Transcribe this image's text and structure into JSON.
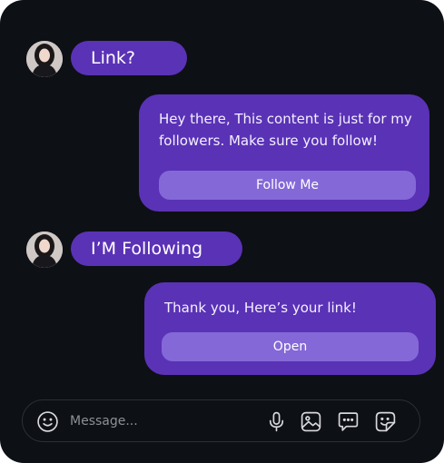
{
  "conversation": {
    "messages": [
      {
        "text": "Link?"
      },
      {
        "text": "Hey there, This content is just for my followers. Make sure you follow!",
        "action": "Follow Me"
      },
      {
        "text": "I’M Following"
      },
      {
        "text": "Thank you, Here’s your link!",
        "action": "Open"
      }
    ]
  },
  "composer": {
    "placeholder": "Message...",
    "icons": [
      "emoji-icon",
      "microphone-icon",
      "image-icon",
      "chat-icon",
      "sticker-icon"
    ]
  },
  "colors": {
    "background": "#0d1015",
    "bubble": "#5a32b6",
    "button": "#8468d8"
  }
}
